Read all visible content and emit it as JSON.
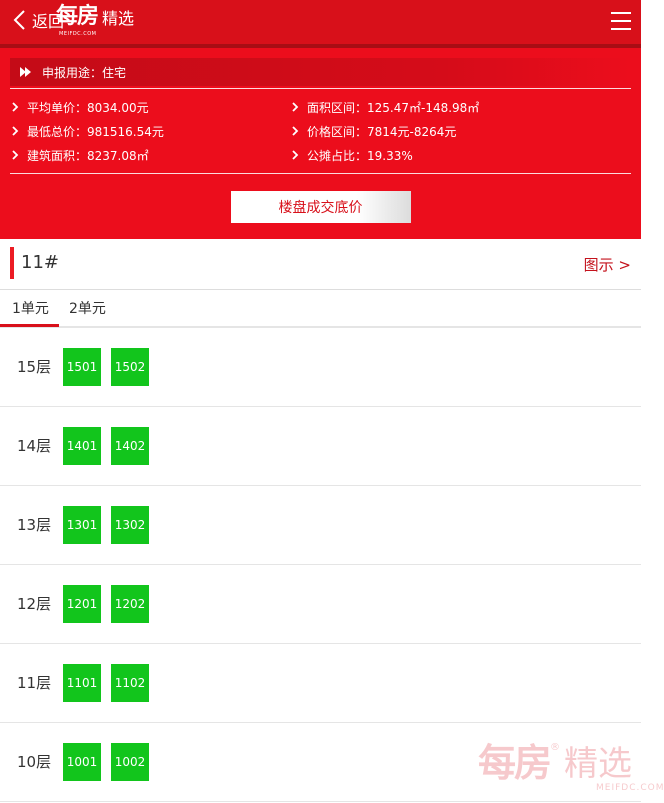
{
  "header": {
    "back_label": "返回",
    "logo_main": "每房",
    "logo_sub": "精选",
    "logo_url": "MEIFDC.COM",
    "menu_icon": "menu-icon"
  },
  "info": {
    "purpose": "申报用途：住宅",
    "items": [
      {
        "label": "平均单价：8034.00元"
      },
      {
        "label": "面积区间：125.47㎡-148.98㎡"
      },
      {
        "label": "最低总价：981516.54元"
      },
      {
        "label": "价格区间：7814元-8264元"
      },
      {
        "label": "建筑面积：8237.08㎡"
      },
      {
        "label": "公摊占比：19.33%"
      }
    ],
    "button_label": "楼盘成交底价"
  },
  "building": {
    "name": "11#",
    "legend_label": "图示 >"
  },
  "tabs": [
    {
      "label": "1单元",
      "active": true
    },
    {
      "label": "2单元",
      "active": false
    }
  ],
  "floors": [
    {
      "label": "15层",
      "rooms": [
        "1501",
        "1502"
      ]
    },
    {
      "label": "14层",
      "rooms": [
        "1401",
        "1402"
      ]
    },
    {
      "label": "13层",
      "rooms": [
        "1301",
        "1302"
      ]
    },
    {
      "label": "12层",
      "rooms": [
        "1201",
        "1202"
      ]
    },
    {
      "label": "11层",
      "rooms": [
        "1101",
        "1102"
      ]
    },
    {
      "label": "10层",
      "rooms": [
        "1001",
        "1002"
      ]
    }
  ],
  "watermark": {
    "main": "每房",
    "sub": "精选",
    "reg": "®",
    "url": "MEIFDC.COM"
  },
  "colors": {
    "header_red": "#d8101a",
    "panel_red": "#ec0d1c",
    "room_green": "#12c51c"
  }
}
